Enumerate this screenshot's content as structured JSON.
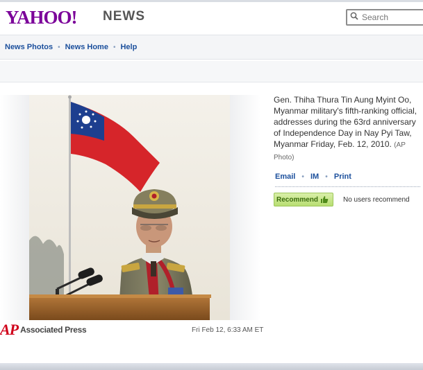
{
  "header": {
    "logo_text": "YAHOO!",
    "section_text": "NEWS",
    "search_placeholder": "Search"
  },
  "nav": {
    "items": [
      {
        "label": "News Photos"
      },
      {
        "label": "News Home"
      },
      {
        "label": "Help"
      }
    ]
  },
  "photo": {
    "caption": "Gen. Thiha Thura Tin Aung Myint Oo, Myanmar military's fifth-ranking official, addresses during the 63rd anniversary of Independence Day in Nay Pyi Taw, Myanmar Friday, Feb. 12, 2010.",
    "credit": "(AP Photo)",
    "source_mark": "AP",
    "source_text": "Associated Press",
    "timestamp": "Fri Feb 12, 6:33 AM ET"
  },
  "share": {
    "email": "Email",
    "im": "IM",
    "print": "Print"
  },
  "recommend": {
    "button_label": "Recommend",
    "count_text": "No users recommend"
  },
  "colors": {
    "brand": "#7b0099",
    "link": "#1b4f9c",
    "ap_red": "#d0021b"
  }
}
